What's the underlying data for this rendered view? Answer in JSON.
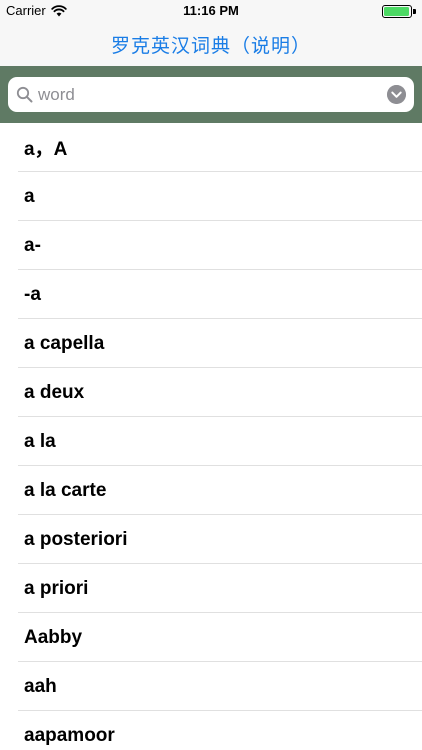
{
  "status_bar": {
    "carrier": "Carrier",
    "time": "11:16 PM",
    "battery_level": 0.95
  },
  "nav": {
    "title": "罗克英汉词典（说明）"
  },
  "search": {
    "placeholder": "word",
    "value": ""
  },
  "words": [
    "a，A",
    "a",
    "a-",
    "-a",
    "a capella",
    "a deux",
    "a la",
    "a la carte",
    "a posteriori",
    "a priori",
    "Aabby",
    "aah",
    "aapamoor"
  ]
}
